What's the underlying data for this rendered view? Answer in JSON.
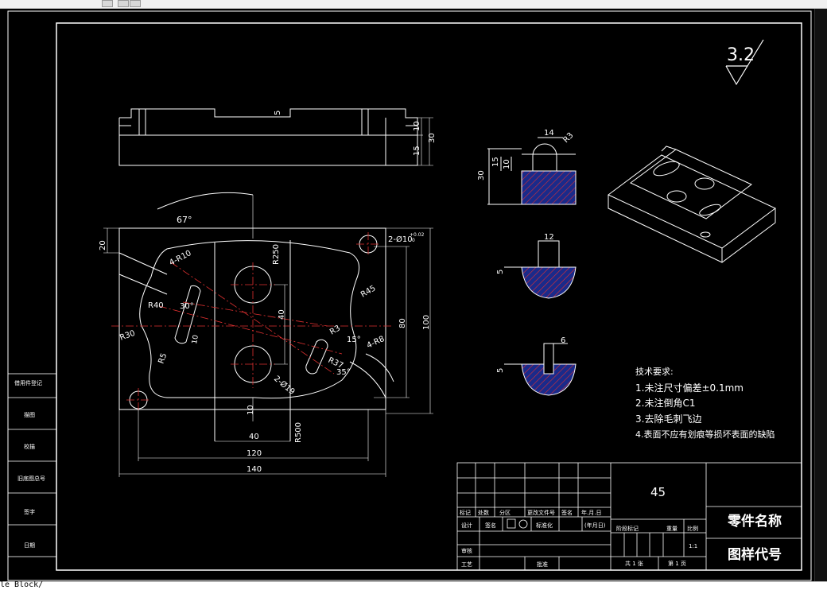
{
  "app": {
    "status_text": "le Block/"
  },
  "drawing": {
    "roughness_value": "3.2",
    "dims": {
      "d5_top": "5",
      "d10_top": "10",
      "d15_top": "15",
      "d30_top": "30",
      "d67": "67°",
      "d20": "20",
      "r10": "4-R10",
      "r250": "R250",
      "hole_callout": "2-Ø10",
      "tol_top": "+0.02",
      "tol_bot": "0",
      "r40": "R40",
      "a30": "30°",
      "r30": "R30",
      "d40": "40",
      "r45": "R45",
      "r3": "R3",
      "a15": "15°",
      "r8": "4-R8",
      "d80": "80",
      "d100": "100",
      "r37": "R37",
      "a35": "35°",
      "d19": "2-Ø19",
      "r5": "R5",
      "d10b": "10",
      "d10c": "10",
      "r500": "R500",
      "d40b": "40",
      "d120": "120",
      "d140": "140",
      "s14": "14",
      "s_r3": "R3",
      "s15": "15",
      "s10": "10",
      "s30": "30",
      "s12": "12",
      "s5a": "5",
      "s6": "6",
      "s5b": "5"
    },
    "notes": {
      "title": "技术要求:",
      "items": [
        "1.未注尺寸偏差±0.1mm",
        "2.未注倒角C1",
        "3.去除毛刺飞边",
        "4.表面不应有划痕等损坏表面的缺陷"
      ]
    },
    "left_strip": [
      "借用件登记",
      "描图",
      "校描",
      "旧底图总号",
      "签字",
      "日期"
    ],
    "title_block": {
      "material": "45",
      "part_name": "零件名称",
      "drawing_code": "图样代号",
      "row_headers": [
        "标记",
        "处数",
        "分区",
        "更改文件号",
        "签名",
        "年.月.日"
      ],
      "design_row": [
        "设计",
        "签名",
        "标准化",
        "(年月日)"
      ],
      "stage_headers": [
        "阶段标记",
        "重量",
        "比例"
      ],
      "scale": "1:1",
      "check": "审核",
      "process": "工艺",
      "approve": "批准",
      "sheets": "共 1 张",
      "page": "第 1 页"
    }
  }
}
